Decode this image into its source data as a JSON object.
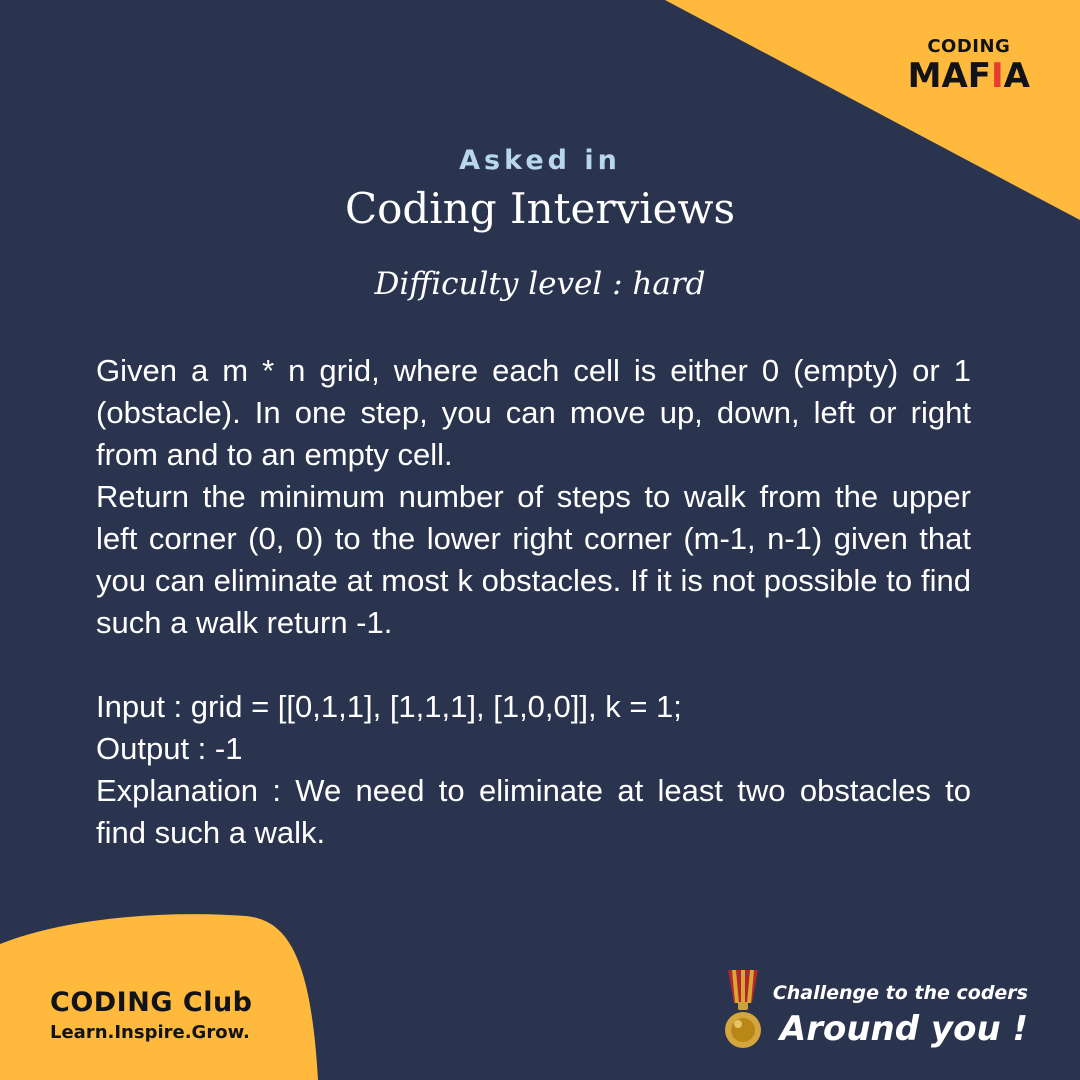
{
  "branding": {
    "top_line1": "CODING",
    "top_line2_prefix": "MAF",
    "top_line2_tie": "I",
    "top_line2_suffix": "A",
    "club_title": "CODING Club",
    "club_tagline": "Learn.Inspire.Grow."
  },
  "header": {
    "eyebrow": "Asked in",
    "title": "Coding Interviews",
    "difficulty": "Difficulty level : hard"
  },
  "problem": {
    "paragraph1": "Given a m * n grid, where each cell is either 0 (empty) or 1 (obstacle). In one step, you can move up, down, left or right from and to an empty cell.",
    "paragraph2": "Return the minimum number of steps to walk from the upper left corner (0, 0) to the lower right corner (m-1, n-1) given that you can eliminate at most k obstacles. If it is not possible to find such a walk return -1.",
    "input": "Input : grid = [[0,1,1], [1,1,1], [1,0,0]], k = 1;",
    "output": "Output : -1",
    "explanation": "Explanation : We need to eliminate at least two obstacles to find such a walk."
  },
  "footer": {
    "challenge_line1": "Challenge to the coders",
    "challenge_line2": "Around you !"
  },
  "colors": {
    "background": "#2a344f",
    "accent": "#ffb93d",
    "light_blue": "#b8d7ef",
    "white": "#ffffff",
    "dark_text": "#111318",
    "red": "#e63b2e",
    "gold": "#d8a72f"
  },
  "icons": {
    "medal": "medal-icon",
    "tie": "tie-icon"
  }
}
